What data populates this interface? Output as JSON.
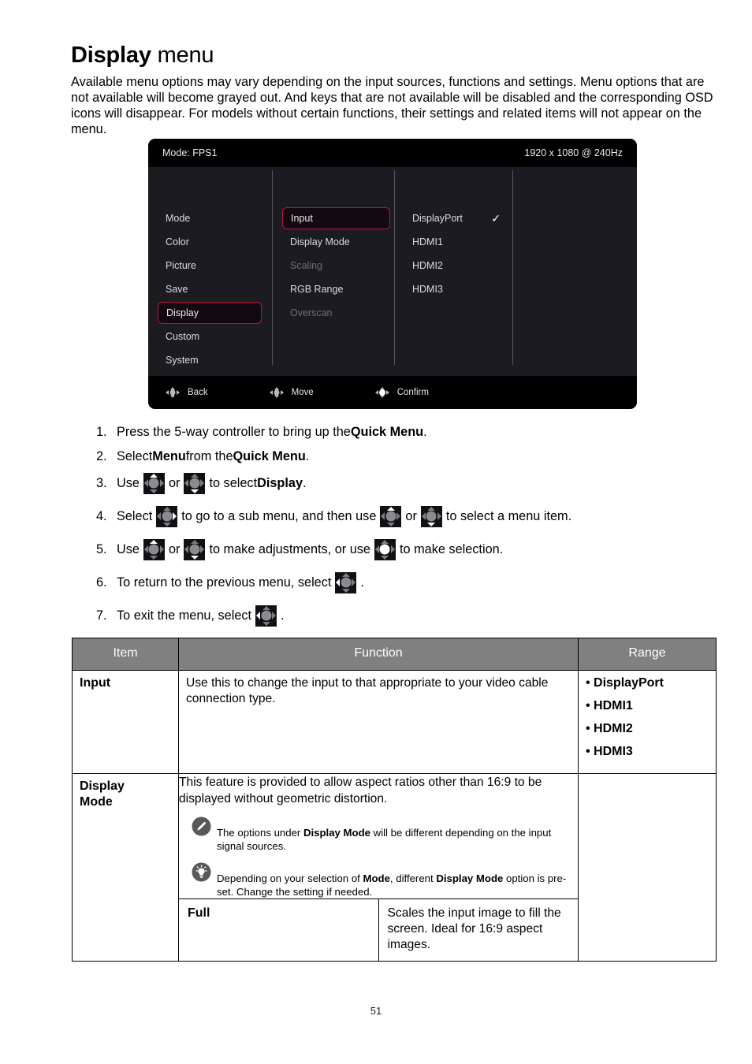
{
  "heading": {
    "bold": "Display",
    "normal": " menu"
  },
  "intro": "Available menu options may vary depending on the input sources, functions and settings. Menu options that are not available will become grayed out. And keys that are not available will be disabled and the corresponding OSD icons will disappear. For models without certain functions, their settings and related items will not appear on the menu.",
  "osd": {
    "mode_label": "Mode: FPS1",
    "resolution": "1920 x 1080 @ 240Hz",
    "accent_color": "#b8143c",
    "main_menu": [
      {
        "label": "Mode",
        "state": "normal"
      },
      {
        "label": "Color",
        "state": "normal"
      },
      {
        "label": "Picture",
        "state": "normal"
      },
      {
        "label": "Save",
        "state": "normal"
      },
      {
        "label": "Display",
        "state": "selected"
      },
      {
        "label": "Custom",
        "state": "normal"
      },
      {
        "label": "System",
        "state": "normal"
      }
    ],
    "sub_menu": [
      {
        "label": "Input",
        "state": "selected"
      },
      {
        "label": "Display Mode",
        "state": "normal"
      },
      {
        "label": "Scaling",
        "state": "disabled"
      },
      {
        "label": "RGB Range",
        "state": "normal"
      },
      {
        "label": "Overscan",
        "state": "disabled"
      }
    ],
    "options": [
      {
        "label": "DisplayPort",
        "checked": true
      },
      {
        "label": "HDMI1",
        "checked": false
      },
      {
        "label": "HDMI2",
        "checked": false
      },
      {
        "label": "HDMI3",
        "checked": false
      }
    ],
    "check_glyph": "✓",
    "footer": [
      {
        "label": "Back",
        "icon": "five-way-controller-left-icon"
      },
      {
        "label": "Move",
        "icon": "five-way-controller-move-icon"
      },
      {
        "label": "Confirm",
        "icon": "five-way-controller-press-icon"
      }
    ]
  },
  "steps": [
    {
      "num": "1.",
      "parts": [
        {
          "t": "text",
          "v": "Press the 5-way controller to bring up the "
        },
        {
          "t": "bold",
          "v": "Quick Menu"
        },
        {
          "t": "text",
          "v": "."
        }
      ]
    },
    {
      "num": "2.",
      "parts": [
        {
          "t": "text",
          "v": "Select "
        },
        {
          "t": "bold",
          "v": "Menu"
        },
        {
          "t": "text",
          "v": " from the "
        },
        {
          "t": "bold",
          "v": "Quick Menu"
        },
        {
          "t": "text",
          "v": "."
        }
      ]
    },
    {
      "num": "3.",
      "parts": [
        {
          "t": "text",
          "v": "Use "
        },
        {
          "t": "icon",
          "v": "controller-up-icon"
        },
        {
          "t": "text",
          "v": " or "
        },
        {
          "t": "icon",
          "v": "controller-down-icon"
        },
        {
          "t": "text",
          "v": " to select "
        },
        {
          "t": "bold",
          "v": "Display"
        },
        {
          "t": "text",
          "v": "."
        }
      ]
    },
    {
      "num": "4.",
      "parts": [
        {
          "t": "text",
          "v": "Select "
        },
        {
          "t": "icon",
          "v": "controller-right-icon"
        },
        {
          "t": "text",
          "v": " to go to a sub menu, and then use "
        },
        {
          "t": "icon",
          "v": "controller-up-icon"
        },
        {
          "t": "text",
          "v": " or "
        },
        {
          "t": "icon",
          "v": "controller-down-icon"
        },
        {
          "t": "text",
          "v": " to select a menu item."
        }
      ]
    },
    {
      "num": "5.",
      "parts": [
        {
          "t": "text",
          "v": "Use "
        },
        {
          "t": "icon",
          "v": "controller-up-icon"
        },
        {
          "t": "text",
          "v": " or "
        },
        {
          "t": "icon",
          "v": "controller-down-icon"
        },
        {
          "t": "text",
          "v": " to make adjustments, or use "
        },
        {
          "t": "icon",
          "v": "controller-press-icon"
        },
        {
          "t": "text",
          "v": " to make selection."
        }
      ]
    },
    {
      "num": "6.",
      "parts": [
        {
          "t": "text",
          "v": "To return to the previous menu, select "
        },
        {
          "t": "icon",
          "v": "controller-left-icon"
        },
        {
          "t": "text",
          "v": "."
        }
      ]
    },
    {
      "num": "7.",
      "parts": [
        {
          "t": "text",
          "v": "To exit the menu, select "
        },
        {
          "t": "icon",
          "v": "controller-left-icon"
        },
        {
          "t": "text",
          "v": "."
        }
      ]
    }
  ],
  "table": {
    "headers": {
      "item": "Item",
      "function": "Function",
      "range": "Range"
    },
    "header_bg": "#808080",
    "rows": {
      "input": {
        "item": "Input",
        "function": "Use this to change the input to that appropriate to your video cable connection type.",
        "range": [
          "DisplayPort",
          "HDMI1",
          "HDMI2",
          "HDMI3"
        ]
      },
      "display_mode": {
        "item_line1": "Display",
        "item_line2": "Mode",
        "function": "This feature is provided to allow aspect ratios other than 16:9 to be displayed without geometric distortion.",
        "notes": [
          {
            "icon": "pencil-note-icon",
            "parts": [
              {
                "t": "text",
                "v": "The options under "
              },
              {
                "t": "bold",
                "v": "Display Mode"
              },
              {
                "t": "text",
                "v": " will be different depending on the input signal sources."
              }
            ]
          },
          {
            "icon": "lightbulb-tip-icon",
            "parts": [
              {
                "t": "text",
                "v": "Depending on your selection of "
              },
              {
                "t": "bold",
                "v": "Mode"
              },
              {
                "t": "text",
                "v": ", different "
              },
              {
                "t": "bold",
                "v": "Display Mode"
              },
              {
                "t": "text",
                "v": " option is pre-set. Change the setting if needed."
              }
            ]
          }
        ],
        "sub_rows": [
          {
            "name": "Full",
            "desc": "Scales the input image to fill the screen. Ideal for 16:9 aspect images."
          }
        ]
      }
    }
  },
  "page_number": "51"
}
